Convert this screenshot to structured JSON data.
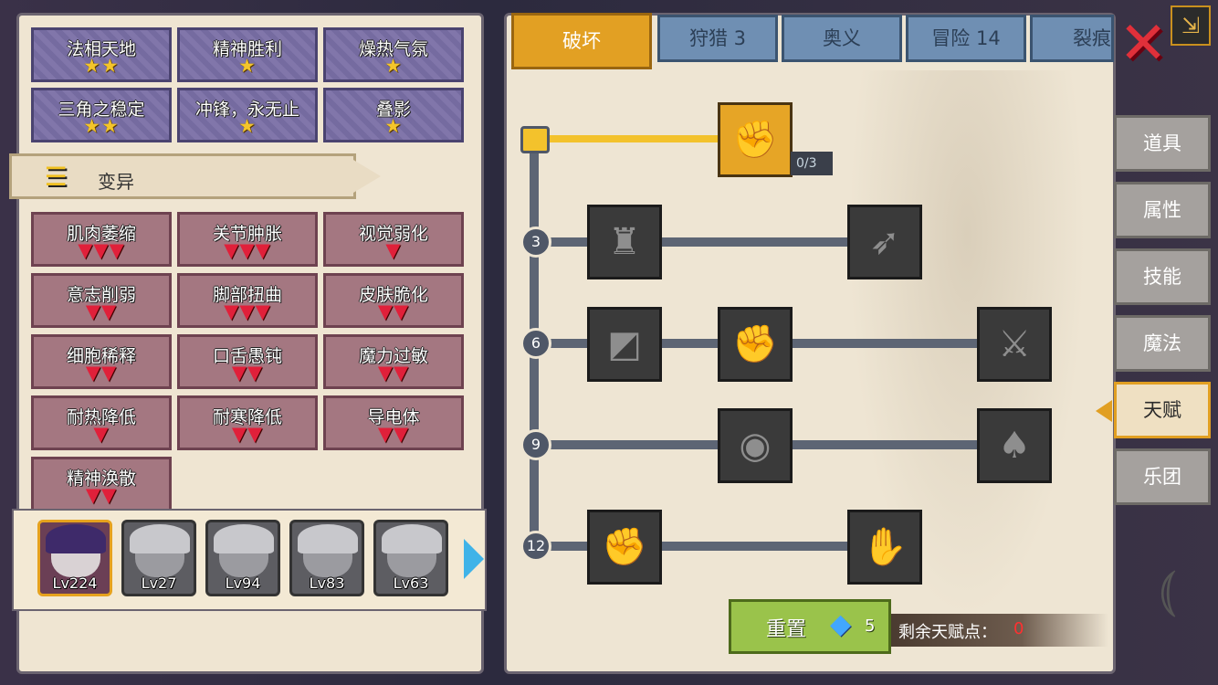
{
  "blessings": [
    {
      "name": "法相天地",
      "stars": "★★"
    },
    {
      "name": "精神胜利",
      "stars": "★"
    },
    {
      "name": "燥热气氛",
      "stars": "★"
    },
    {
      "name": "三角之稳定",
      "stars": "★★"
    },
    {
      "name": "冲锋，永无止",
      "stars": "★"
    },
    {
      "name": "叠影",
      "stars": "★"
    }
  ],
  "section": {
    "label": "变异",
    "icon": "dna-icon"
  },
  "mutations": [
    {
      "name": "肌肉萎缩",
      "marks": "▼▼▼"
    },
    {
      "name": "关节肿胀",
      "marks": "▼▼▼"
    },
    {
      "name": "视觉弱化",
      "marks": "▼"
    },
    {
      "name": "意志削弱",
      "marks": "▼▼"
    },
    {
      "name": "脚部扭曲",
      "marks": "▼▼▼"
    },
    {
      "name": "皮肤脆化",
      "marks": "▼▼"
    },
    {
      "name": "细胞稀释",
      "marks": "▼▼"
    },
    {
      "name": "口舌愚钝",
      "marks": "▼▼"
    },
    {
      "name": "魔力过敏",
      "marks": "▼▼"
    },
    {
      "name": "耐热降低",
      "marks": "▼"
    },
    {
      "name": "耐寒降低",
      "marks": "▼▼"
    },
    {
      "name": "导电体",
      "marks": "▼▼"
    },
    {
      "name": "精神涣散",
      "marks": "▼▼"
    }
  ],
  "heroes": [
    {
      "level": "Lv224",
      "selected": true
    },
    {
      "level": "Lv27",
      "selected": false
    },
    {
      "level": "Lv94",
      "selected": false
    },
    {
      "level": "Lv83",
      "selected": false
    },
    {
      "level": "Lv63",
      "selected": false
    }
  ],
  "tabs": [
    "破坏",
    "狩猎 3",
    "奥义",
    "冒险 14",
    "裂痕"
  ],
  "active_tab": "破坏",
  "tree": {
    "levels": [
      "3",
      "6",
      "9",
      "12"
    ],
    "start_counter": "0/3"
  },
  "reset": {
    "label": "重置",
    "cost": "5"
  },
  "points": {
    "label": "剩余天赋点：",
    "value": "0"
  },
  "side_tabs": [
    "道具",
    "属性",
    "技能",
    "魔法",
    "天赋",
    "乐团"
  ],
  "active_side_tab": "天赋",
  "colors": {
    "accent": "#e2a023",
    "negative": "#e0203a",
    "star": "#f4c52a",
    "reset": "#9ac34b"
  }
}
